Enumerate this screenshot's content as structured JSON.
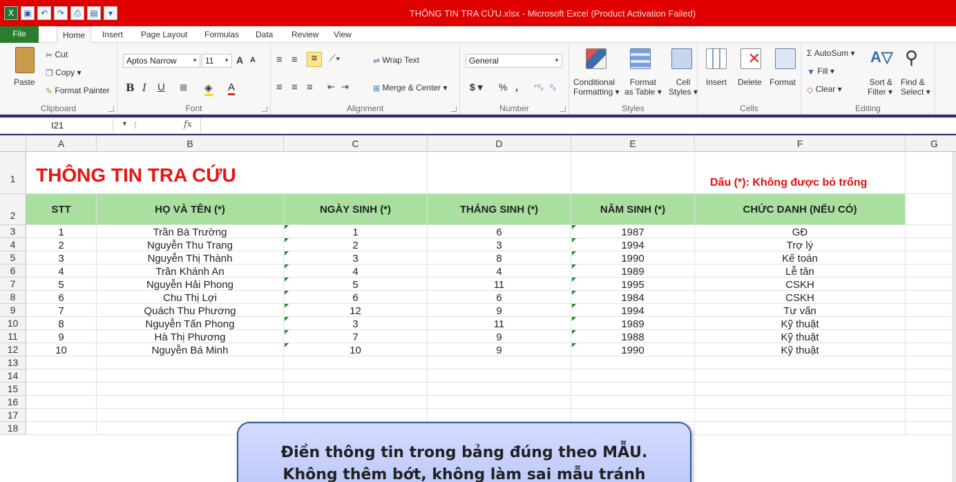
{
  "window": {
    "title": "THÔNG TIN TRA CỨU.xlsx - Microsoft Excel (Product Activation Failed)"
  },
  "qat": {
    "customize_label": "▾"
  },
  "tabs": [
    "File",
    "Home",
    "Insert",
    "Page Layout",
    "Formulas",
    "Data",
    "Review",
    "View"
  ],
  "ribbon": {
    "clipboard": {
      "paste": "Paste",
      "cut": "Cut",
      "copy": "Copy ▾",
      "format_painter": "Format Painter",
      "label": "Clipboard"
    },
    "font": {
      "name": "Aptos Narrow",
      "size": "11",
      "bold": "B",
      "italic": "I",
      "underline": "U",
      "grow": "A",
      "shrink": "A",
      "font_color": "A",
      "label": "Font"
    },
    "alignment": {
      "wrap": "Wrap Text",
      "merge": "Merge & Center ▾",
      "label": "Alignment"
    },
    "number": {
      "format": "General",
      "currency": "$ ▾",
      "percent": "%",
      "comma": ",",
      "inc_dec": "⁺⁰₀",
      "dec_dec": "⁰₀",
      "label": "Number"
    },
    "styles": {
      "conditional": "Conditional",
      "conditional2": "Formatting ▾",
      "format_table": "Format",
      "format_table2": "as Table ▾",
      "cell_styles": "Cell",
      "cell_styles2": "Styles ▾",
      "label": "Styles"
    },
    "cells": {
      "insert": "Insert",
      "delete": "Delete",
      "format": "Format",
      "label": "Cells"
    },
    "editing": {
      "autosum": "Σ AutoSum ▾",
      "fill": "Fill ▾",
      "clear": "Clear ▾",
      "sort": "Sort &",
      "sort2": "Filter ▾",
      "find": "Find &",
      "find2": "Select ▾",
      "label": "Editing"
    }
  },
  "formula_bar": {
    "name_box": "I21",
    "fx": "fx",
    "formula": ""
  },
  "columns": [
    "A",
    "B",
    "C",
    "D",
    "E",
    "F",
    "G"
  ],
  "rows": [
    "1",
    "2",
    "3",
    "4",
    "5",
    "6",
    "7",
    "8",
    "9",
    "10",
    "11",
    "12",
    "13",
    "14",
    "15",
    "16",
    "17",
    "18"
  ],
  "sheet": {
    "title": "THÔNG TIN TRA CỨU",
    "note": "Dấu (*): Không được bỏ trống",
    "headers": [
      "STT",
      "HỌ VÀ TÊN (*)",
      "NGÀY SINH (*)",
      "THÁNG SINH (*)",
      "NĂM SINH (*)",
      "CHỨC DANH (NẾU CÓ)"
    ],
    "records": [
      [
        "1",
        "Trần Bá Trường",
        "1",
        "6",
        "1987",
        "GĐ"
      ],
      [
        "2",
        "Nguyễn Thu Trang",
        "2",
        "3",
        "1994",
        "Trợ lý"
      ],
      [
        "3",
        "Nguyễn Thị Thành",
        "3",
        "8",
        "1990",
        "Kế toán"
      ],
      [
        "4",
        "Trần Khánh An",
        "4",
        "4",
        "1989",
        "Lễ tân"
      ],
      [
        "5",
        "Nguyễn Hải Phong",
        "5",
        "11",
        "1995",
        "CSKH"
      ],
      [
        "6",
        "Chu Thị Lợi",
        "6",
        "6",
        "1984",
        "CSKH"
      ],
      [
        "7",
        "Quách Thu Phương",
        "12",
        "9",
        "1994",
        "Tư vấn"
      ],
      [
        "8",
        "Nguyễn Tấn Phong",
        "3",
        "11",
        "1989",
        "Kỹ thuật"
      ],
      [
        "9",
        "Hà Thị Phương",
        "7",
        "9",
        "1988",
        "Kỹ thuật"
      ],
      [
        "10",
        "Nguyễn Bá Minh",
        "10",
        "9",
        "1990",
        "Kỹ thuật"
      ]
    ]
  },
  "callout": {
    "line1": "Điền thông tin trong bảng đúng theo MẪU.",
    "line2": "Không thêm bớt, không làm sai mẫu tránh"
  },
  "colors": {
    "title_bar": "#e00000",
    "file_tab": "#2a7d2e",
    "header_fill": "#a9e0a0",
    "title_red": "#ee1111"
  }
}
